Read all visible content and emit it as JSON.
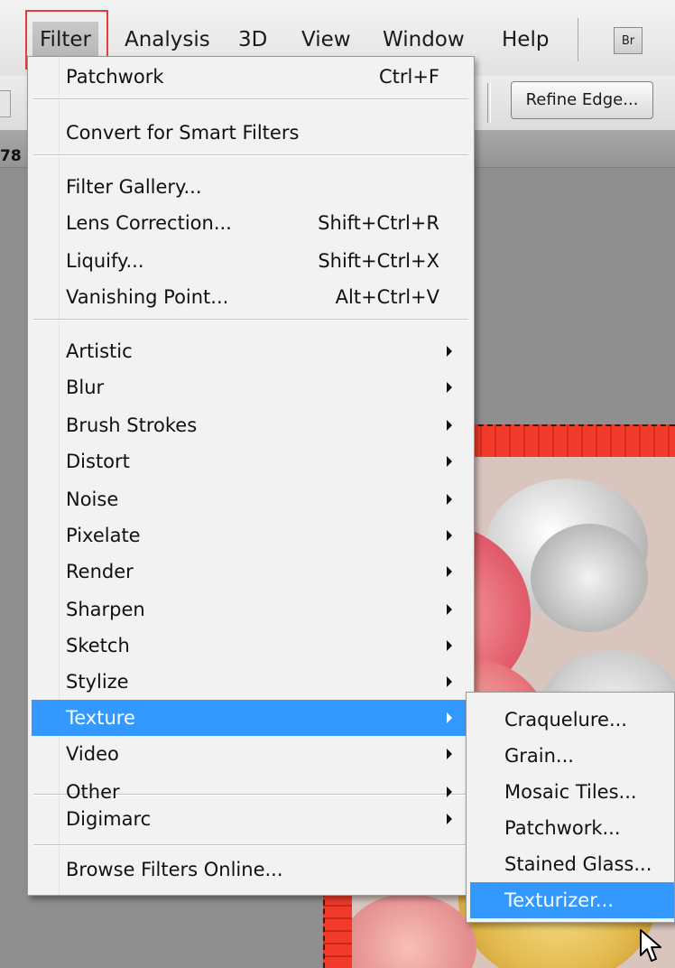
{
  "menubar": {
    "items": [
      "Filter",
      "Analysis",
      "3D",
      "View",
      "Window",
      "Help"
    ],
    "br_label": "Br"
  },
  "optionsbar": {
    "refine_edge_label": "Refine Edge..."
  },
  "doc_tab_fragment": "78",
  "filter_menu": {
    "items": [
      {
        "label": "Patchwork",
        "shortcut": "Ctrl+F"
      },
      {
        "label": "Convert for Smart Filters"
      },
      {
        "label": "Filter Gallery..."
      },
      {
        "label": "Lens Correction...",
        "shortcut": "Shift+Ctrl+R"
      },
      {
        "label": "Liquify...",
        "shortcut": "Shift+Ctrl+X"
      },
      {
        "label": "Vanishing Point...",
        "shortcut": "Alt+Ctrl+V"
      },
      {
        "label": "Artistic",
        "submenu": true
      },
      {
        "label": "Blur",
        "submenu": true
      },
      {
        "label": "Brush Strokes",
        "submenu": true
      },
      {
        "label": "Distort",
        "submenu": true
      },
      {
        "label": "Noise",
        "submenu": true
      },
      {
        "label": "Pixelate",
        "submenu": true
      },
      {
        "label": "Render",
        "submenu": true
      },
      {
        "label": "Sharpen",
        "submenu": true
      },
      {
        "label": "Sketch",
        "submenu": true
      },
      {
        "label": "Stylize",
        "submenu": true
      },
      {
        "label": "Texture",
        "submenu": true,
        "highlighted": true
      },
      {
        "label": "Video",
        "submenu": true
      },
      {
        "label": "Other",
        "submenu": true
      },
      {
        "label": "Digimarc",
        "submenu": true
      },
      {
        "label": "Browse Filters Online..."
      }
    ]
  },
  "texture_submenu": {
    "items": [
      {
        "label": "Craquelure..."
      },
      {
        "label": "Grain..."
      },
      {
        "label": "Mosaic Tiles..."
      },
      {
        "label": "Patchwork..."
      },
      {
        "label": "Stained Glass..."
      },
      {
        "label": "Texturizer...",
        "highlighted": true
      }
    ]
  },
  "colors": {
    "highlight": "#3399ff",
    "callout_red": "#e83a3a"
  }
}
